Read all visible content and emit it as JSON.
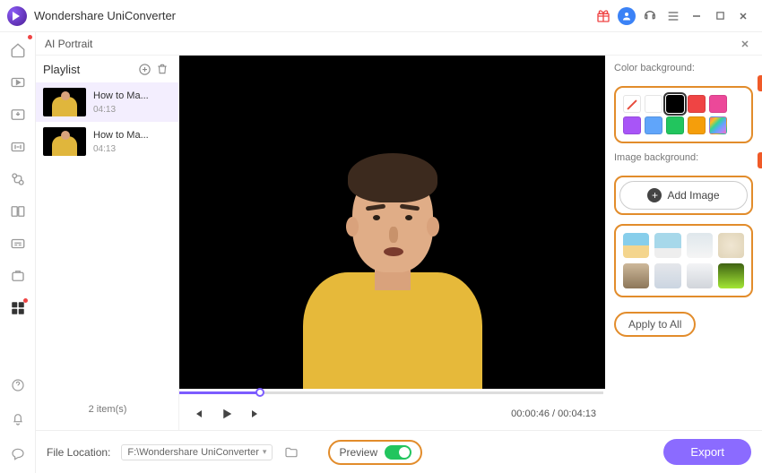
{
  "app": {
    "title": "Wondershare UniConverter"
  },
  "module": {
    "name": "AI Portrait"
  },
  "playlist": {
    "heading": "Playlist",
    "items": [
      {
        "title": "How to Ma...",
        "duration": "04:13"
      },
      {
        "title": "How to Ma...",
        "duration": "04:13"
      }
    ],
    "count_text": "2 item(s)"
  },
  "player": {
    "current_time": "00:00:46",
    "total_time": "00:04:13",
    "progress_percent": 19
  },
  "right_panel": {
    "color_label": "Color background:",
    "image_label": "Image background:",
    "add_image_label": "Add Image",
    "apply_all_label": "Apply to All",
    "colors": [
      {
        "name": "none",
        "value": "transparent"
      },
      {
        "name": "white",
        "value": "#ffffff"
      },
      {
        "name": "black",
        "value": "#000000",
        "selected": true
      },
      {
        "name": "red",
        "value": "#ef4444"
      },
      {
        "name": "pink",
        "value": "#ec4899"
      },
      {
        "name": "purple",
        "value": "#a855f7"
      },
      {
        "name": "blue",
        "value": "#60a5fa"
      },
      {
        "name": "green",
        "value": "#22c55e"
      },
      {
        "name": "orange",
        "value": "#f59e0b"
      },
      {
        "name": "rainbow",
        "value": "rainbow"
      }
    ]
  },
  "footer": {
    "location_label": "File Location:",
    "location_value": "F:\\Wondershare UniConverter",
    "preview_label": "Preview",
    "preview_on": true,
    "export_label": "Export"
  }
}
